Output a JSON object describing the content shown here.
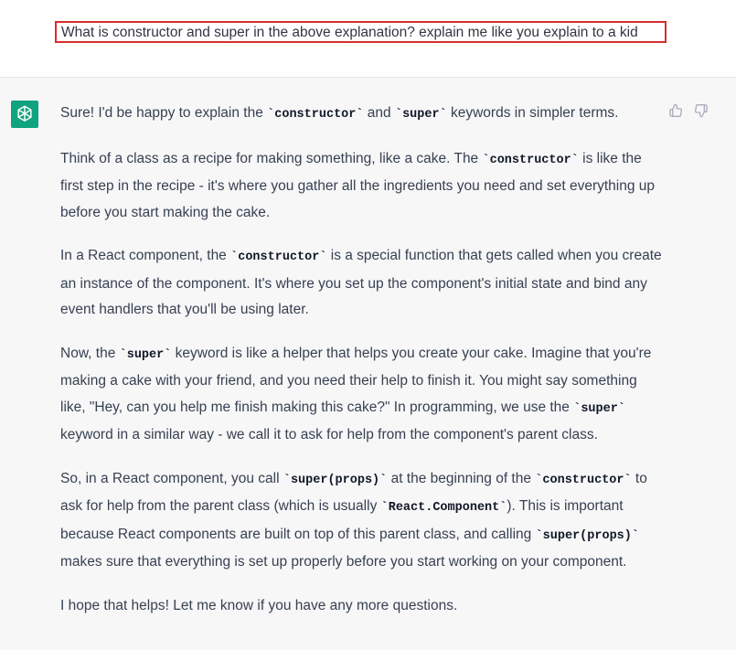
{
  "user": {
    "message": "What is constructor and super in the above explanation? explain me like you explain to a kid"
  },
  "assistant": {
    "paragraphs": [
      [
        {
          "t": "Sure! I'd be happy to explain the "
        },
        {
          "t": "`constructor`",
          "code": true
        },
        {
          "t": " and "
        },
        {
          "t": "`super`",
          "code": true
        },
        {
          "t": " keywords in simpler terms."
        }
      ],
      [
        {
          "t": "Think of a class as a recipe for making something, like a cake. The "
        },
        {
          "t": "`constructor`",
          "code": true
        },
        {
          "t": " is like the first step in the recipe - it's where you gather all the ingredients you need and set everything up before you start making the cake."
        }
      ],
      [
        {
          "t": "In a React component, the "
        },
        {
          "t": "`constructor`",
          "code": true
        },
        {
          "t": " is a special function that gets called when you create an instance of the component. It's where you set up the component's initial state and bind any event handlers that you'll be using later."
        }
      ],
      [
        {
          "t": "Now, the "
        },
        {
          "t": "`super`",
          "code": true
        },
        {
          "t": " keyword is like a helper that helps you create your cake. Imagine that you're making a cake with your friend, and you need their help to finish it. You might say something like, \"Hey, can you help me finish making this cake?\" In programming, we use the "
        },
        {
          "t": "`super`",
          "code": true
        },
        {
          "t": " keyword in a similar way - we call it to ask for help from the component's parent class."
        }
      ],
      [
        {
          "t": "So, in a React component, you call "
        },
        {
          "t": "`super(props)`",
          "code": true
        },
        {
          "t": " at the beginning of the "
        },
        {
          "t": "`constructor`",
          "code": true
        },
        {
          "t": " to ask for help from the parent class (which is usually "
        },
        {
          "t": "`React.Component`",
          "code": true
        },
        {
          "t": "). This is important because React components are built on top of this parent class, and calling "
        },
        {
          "t": "`super(props)`",
          "code": true
        },
        {
          "t": " makes sure that everything is set up properly before you start working on your component."
        }
      ],
      [
        {
          "t": "I hope that helps! Let me know if you have any more questions."
        }
      ]
    ]
  },
  "icons": {
    "avatar": "openai-logo-icon",
    "like": "thumbs-up-icon",
    "dislike": "thumbs-down-icon"
  },
  "colors": {
    "avatar_bg": "#10a37f",
    "highlight_border": "#d92c2c",
    "assistant_bg": "#f7f7f8"
  }
}
